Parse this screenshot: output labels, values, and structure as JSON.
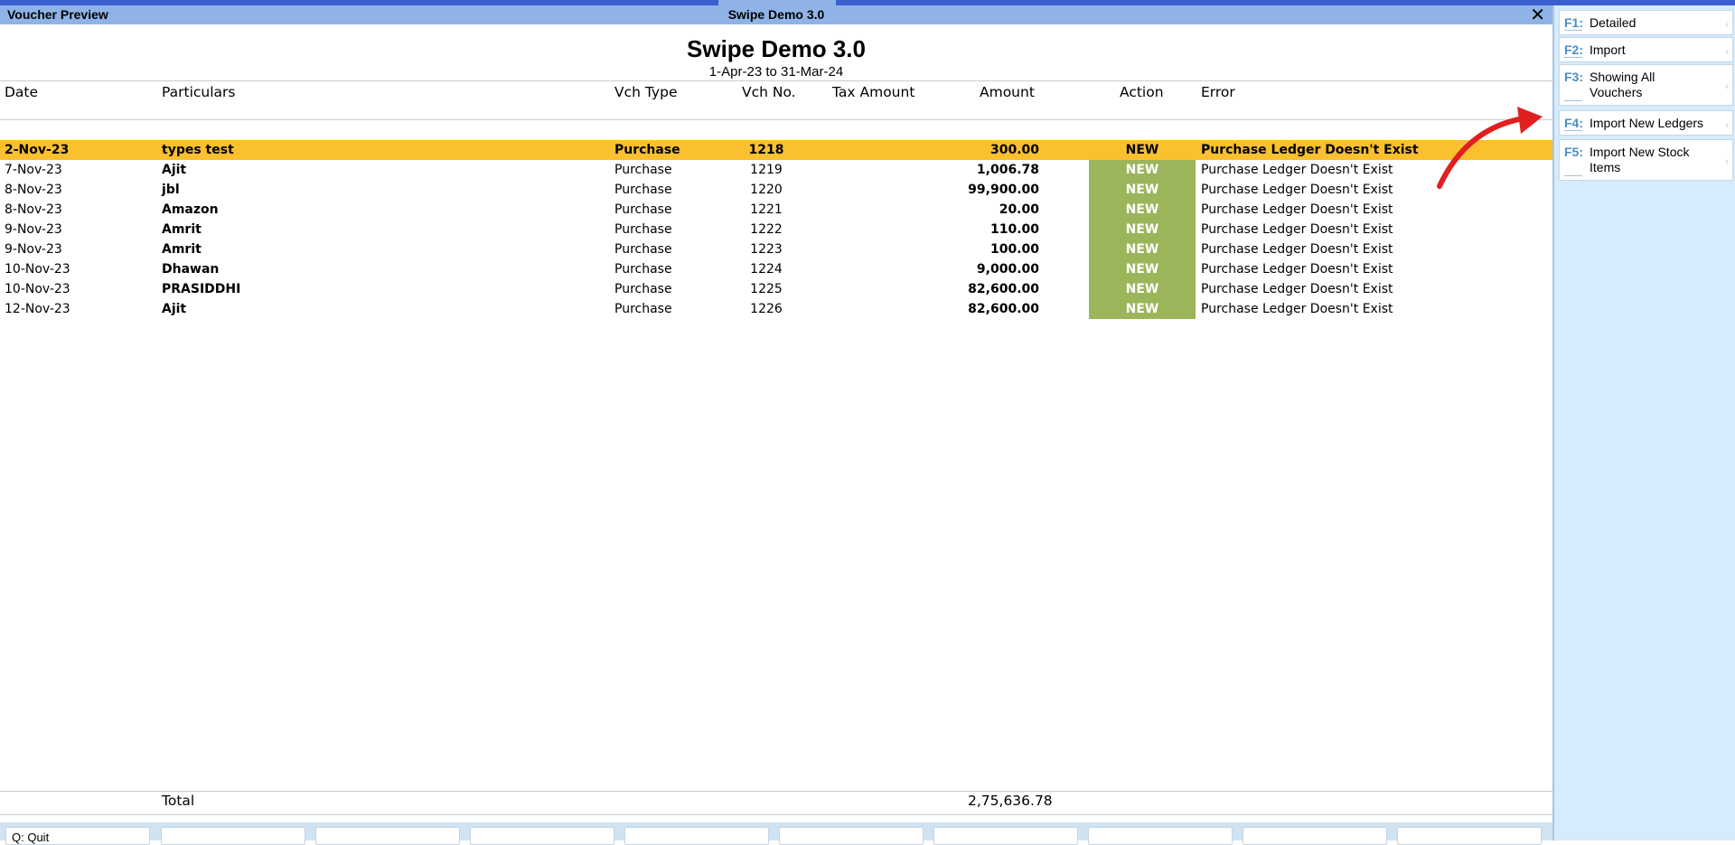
{
  "window": {
    "left_title": "Voucher Preview",
    "center_title": "Swipe Demo 3.0",
    "close_glyph": "✕"
  },
  "report": {
    "company": "Swipe Demo 3.0",
    "period": "1-Apr-23 to 31-Mar-24"
  },
  "columns": {
    "date": "Date",
    "particulars": "Particulars",
    "vch_type": "Vch Type",
    "vch_no": "Vch No.",
    "tax_amount": "Tax Amount",
    "amount": "Amount",
    "action": "Action",
    "error": "Error"
  },
  "rows": [
    {
      "date": "2-Nov-23",
      "particulars": "types test",
      "vch_type": "Purchase",
      "vch_no": "1218",
      "amount": "300.00",
      "action": "NEW",
      "error": "Purchase Ledger Doesn't Exist"
    },
    {
      "date": "7-Nov-23",
      "particulars": "Ajit",
      "vch_type": "Purchase",
      "vch_no": "1219",
      "amount": "1,006.78",
      "action": "NEW",
      "error": "Purchase Ledger Doesn't Exist"
    },
    {
      "date": "8-Nov-23",
      "particulars": "jbl",
      "vch_type": "Purchase",
      "vch_no": "1220",
      "amount": "99,900.00",
      "action": "NEW",
      "error": "Purchase Ledger Doesn't Exist"
    },
    {
      "date": "8-Nov-23",
      "particulars": "Amazon",
      "vch_type": "Purchase",
      "vch_no": "1221",
      "amount": "20.00",
      "action": "NEW",
      "error": "Purchase Ledger Doesn't Exist"
    },
    {
      "date": "9-Nov-23",
      "particulars": "Amrit",
      "vch_type": "Purchase",
      "vch_no": "1222",
      "amount": "110.00",
      "action": "NEW",
      "error": "Purchase Ledger Doesn't Exist"
    },
    {
      "date": "9-Nov-23",
      "particulars": "Amrit",
      "vch_type": "Purchase",
      "vch_no": "1223",
      "amount": "100.00",
      "action": "NEW",
      "error": "Purchase Ledger Doesn't Exist"
    },
    {
      "date": "10-Nov-23",
      "particulars": "Dhawan",
      "vch_type": "Purchase",
      "vch_no": "1224",
      "amount": "9,000.00",
      "action": "NEW",
      "error": "Purchase Ledger Doesn't Exist"
    },
    {
      "date": "10-Nov-23",
      "particulars": "PRASIDDHI",
      "vch_type": "Purchase",
      "vch_no": "1225",
      "amount": "82,600.00",
      "action": "NEW",
      "error": "Purchase Ledger Doesn't Exist"
    },
    {
      "date": "12-Nov-23",
      "particulars": "Ajit",
      "vch_type": "Purchase",
      "vch_no": "1226",
      "amount": "82,600.00",
      "action": "NEW",
      "error": "Purchase Ledger Doesn't Exist"
    }
  ],
  "total": {
    "label": "Total",
    "amount": "2,75,636.78"
  },
  "bottom_bar": {
    "quit_label": "Q: Quit"
  },
  "sidebar": {
    "buttons": [
      {
        "key": "F1:",
        "label": "Detailed"
      },
      {
        "key": "F2:",
        "label": "Import"
      },
      {
        "key": "F3:",
        "label": "Showing All Vouchers"
      },
      {
        "key": "F4:",
        "label": "Import New Ledgers"
      },
      {
        "key": "F5:",
        "label": "Import New Stock Items"
      }
    ]
  },
  "colors": {
    "title_bar": "#8fb3e6",
    "selected_row": "#fbc02d",
    "action_new": "#9bb55a",
    "sidebar_bg": "#d6ebfb",
    "annotation_arrow": "#e02020"
  },
  "icons": {
    "close": "close-icon",
    "annotation": "curved-arrow-icon"
  }
}
